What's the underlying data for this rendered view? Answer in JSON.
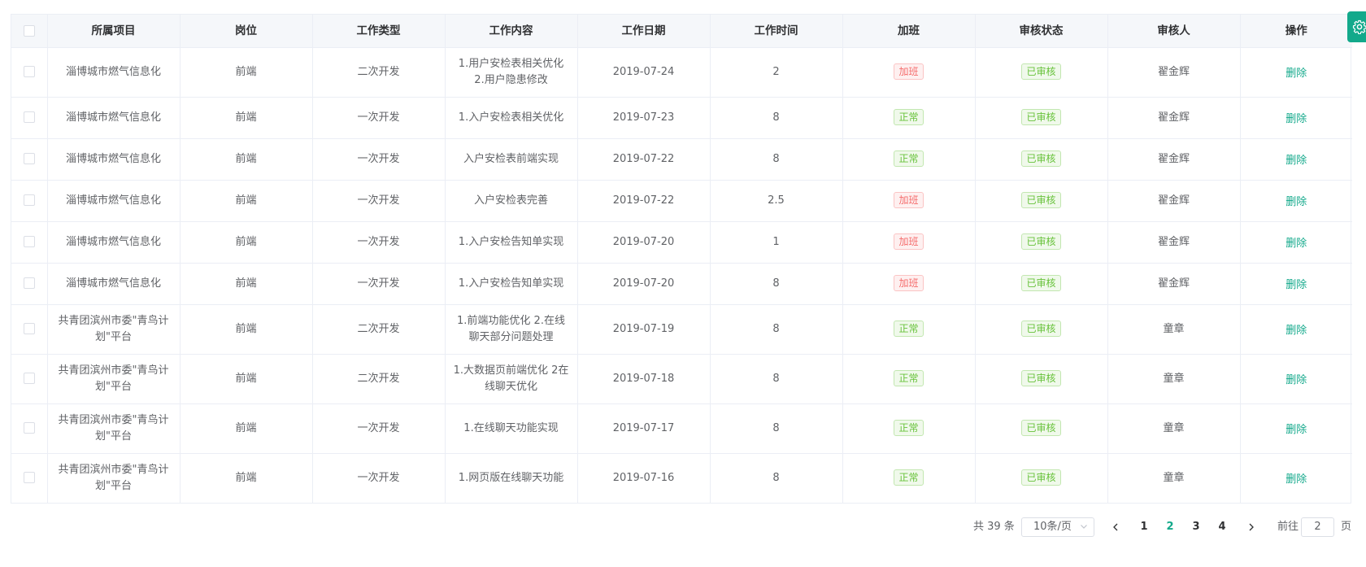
{
  "table": {
    "headers": [
      "所属项目",
      "岗位",
      "工作类型",
      "工作内容",
      "工作日期",
      "工作时间",
      "加班",
      "审核状态",
      "审核人",
      "操作"
    ],
    "rows": [
      {
        "project": "淄博城市燃气信息化",
        "position": "前端",
        "type": "二次开发",
        "content": "1.用户安检表相关优化 2.用户隐患修改",
        "date": "2019-07-24",
        "hours": "2",
        "overtime": "加班",
        "status": "已审核",
        "reviewer": "翟金辉",
        "action": "删除"
      },
      {
        "project": "淄博城市燃气信息化",
        "position": "前端",
        "type": "一次开发",
        "content": "1.入户安检表相关优化",
        "date": "2019-07-23",
        "hours": "8",
        "overtime": "正常",
        "status": "已审核",
        "reviewer": "翟金辉",
        "action": "删除"
      },
      {
        "project": "淄博城市燃气信息化",
        "position": "前端",
        "type": "一次开发",
        "content": "入户安检表前端实现",
        "date": "2019-07-22",
        "hours": "8",
        "overtime": "正常",
        "status": "已审核",
        "reviewer": "翟金辉",
        "action": "删除"
      },
      {
        "project": "淄博城市燃气信息化",
        "position": "前端",
        "type": "一次开发",
        "content": "入户安检表完善",
        "date": "2019-07-22",
        "hours": "2.5",
        "overtime": "加班",
        "status": "已审核",
        "reviewer": "翟金辉",
        "action": "删除"
      },
      {
        "project": "淄博城市燃气信息化",
        "position": "前端",
        "type": "一次开发",
        "content": "1.入户安检告知单实现",
        "date": "2019-07-20",
        "hours": "1",
        "overtime": "加班",
        "status": "已审核",
        "reviewer": "翟金辉",
        "action": "删除"
      },
      {
        "project": "淄博城市燃气信息化",
        "position": "前端",
        "type": "一次开发",
        "content": "1.入户安检告知单实现",
        "date": "2019-07-20",
        "hours": "8",
        "overtime": "加班",
        "status": "已审核",
        "reviewer": "翟金辉",
        "action": "删除"
      },
      {
        "project": "共青团滨州市委\"青鸟计划\"平台",
        "position": "前端",
        "type": "二次开发",
        "content": "1.前端功能优化 2.在线聊天部分问题处理",
        "date": "2019-07-19",
        "hours": "8",
        "overtime": "正常",
        "status": "已审核",
        "reviewer": "童章",
        "action": "删除"
      },
      {
        "project": "共青团滨州市委\"青鸟计划\"平台",
        "position": "前端",
        "type": "二次开发",
        "content": "1.大数据页前端优化 2在线聊天优化",
        "date": "2019-07-18",
        "hours": "8",
        "overtime": "正常",
        "status": "已审核",
        "reviewer": "童章",
        "action": "删除"
      },
      {
        "project": "共青团滨州市委\"青鸟计划\"平台",
        "position": "前端",
        "type": "一次开发",
        "content": "1.在线聊天功能实现",
        "date": "2019-07-17",
        "hours": "8",
        "overtime": "正常",
        "status": "已审核",
        "reviewer": "童章",
        "action": "删除"
      },
      {
        "project": "共青团滨州市委\"青鸟计划\"平台",
        "position": "前端",
        "type": "一次开发",
        "content": "1.网页版在线聊天功能",
        "date": "2019-07-16",
        "hours": "8",
        "overtime": "正常",
        "status": "已审核",
        "reviewer": "童章",
        "action": "删除"
      }
    ]
  },
  "pagination": {
    "total": "共 39 条",
    "page_size": "10条/页",
    "pages": [
      "1",
      "2",
      "3",
      "4"
    ],
    "current": "2",
    "goto_label": "前往",
    "goto_value": "2",
    "page_suffix": "页"
  },
  "icons": {
    "settings": "gear-icon",
    "prev": "chevron-left-icon",
    "next": "chevron-right-icon",
    "select": "chevron-down-icon"
  },
  "colors": {
    "accent": "#13a98b",
    "overtime": "#f56c6c",
    "normal": "#67c23a",
    "header_bg": "#f5f7fa",
    "border": "#ebeef5"
  }
}
